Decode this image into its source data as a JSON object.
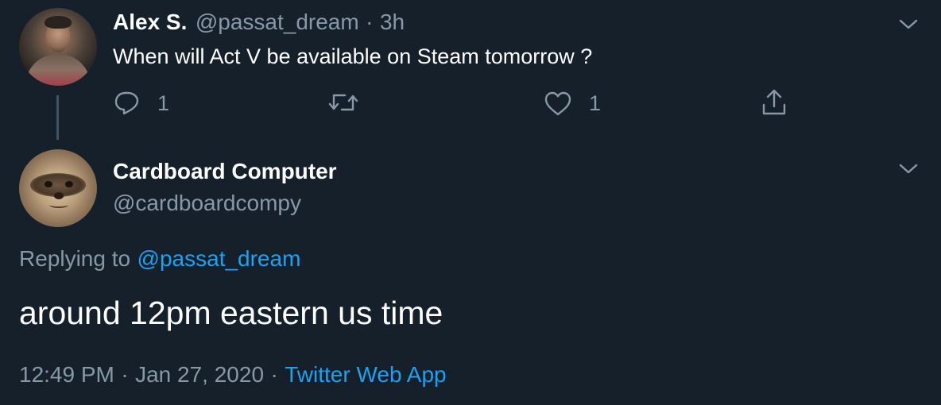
{
  "original_tweet": {
    "author_name": "Alex S.",
    "author_handle": "@passat_dream",
    "separator": "·",
    "time_ago": "3h",
    "text": "When will Act V be available on Steam tomorrow ?",
    "actions": {
      "reply_count": "1",
      "like_count": "1"
    },
    "icons": [
      "reply-icon",
      "retweet-icon",
      "like-icon",
      "share-icon",
      "chevron-down-icon"
    ]
  },
  "reply_tweet": {
    "author_name": "Cardboard Computer",
    "author_handle": "@cardboardcompy",
    "replying_to_label": "Replying to",
    "replying_to_handle": "@passat_dream",
    "text": "around 12pm eastern us time",
    "time": "12:49 PM",
    "separator": "·",
    "date": "Jan 27, 2020",
    "separator2": "·",
    "source": "Twitter Web App"
  },
  "colors": {
    "background": "#15202b",
    "muted": "#8899a6",
    "link": "#1da1f2",
    "text": "#ffffff"
  }
}
